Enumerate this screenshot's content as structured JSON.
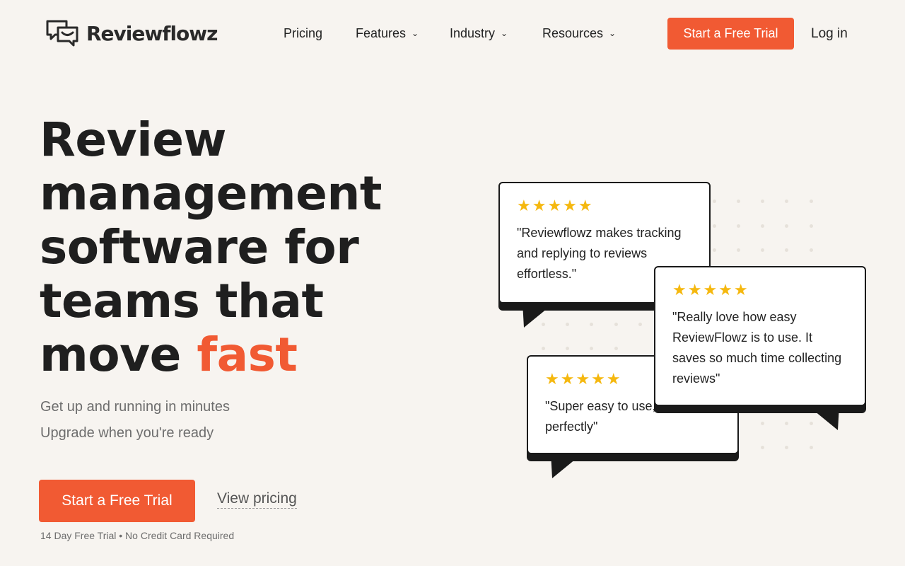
{
  "brand": {
    "name": "Reviewflowz"
  },
  "nav": {
    "items": [
      {
        "label": "Pricing",
        "has_dropdown": false
      },
      {
        "label": "Features",
        "has_dropdown": true
      },
      {
        "label": "Industry",
        "has_dropdown": true
      },
      {
        "label": "Resources",
        "has_dropdown": true
      }
    ],
    "cta": "Start a Free Trial",
    "login": "Log in"
  },
  "hero": {
    "title_lines": [
      "Review",
      "management",
      "software for",
      "teams that",
      "move "
    ],
    "title_accent": "fast",
    "subtitle_1": "Get up and running in minutes",
    "subtitle_2": "Upgrade when you're ready",
    "cta": "Start a Free Trial",
    "pricing_link": "View pricing",
    "note": "14 Day Free Trial • No Credit Card Required"
  },
  "reviews": [
    {
      "stars": "★★★★★",
      "rating": 5,
      "quote": "\"Reviewflowz makes tracking and replying to reviews effortless.\""
    },
    {
      "stars": "★★★★★",
      "rating": 5,
      "quote": "\"Really love how easy ReviewFlowz is to use. It saves so much time collecting reviews\""
    },
    {
      "stars": "★★★★★",
      "rating": 5,
      "quote": "\"Super easy to use, worked perfectly\""
    }
  ],
  "colors": {
    "accent": "#f15a33",
    "background": "#f7f4f0",
    "star": "#f5b80f"
  }
}
